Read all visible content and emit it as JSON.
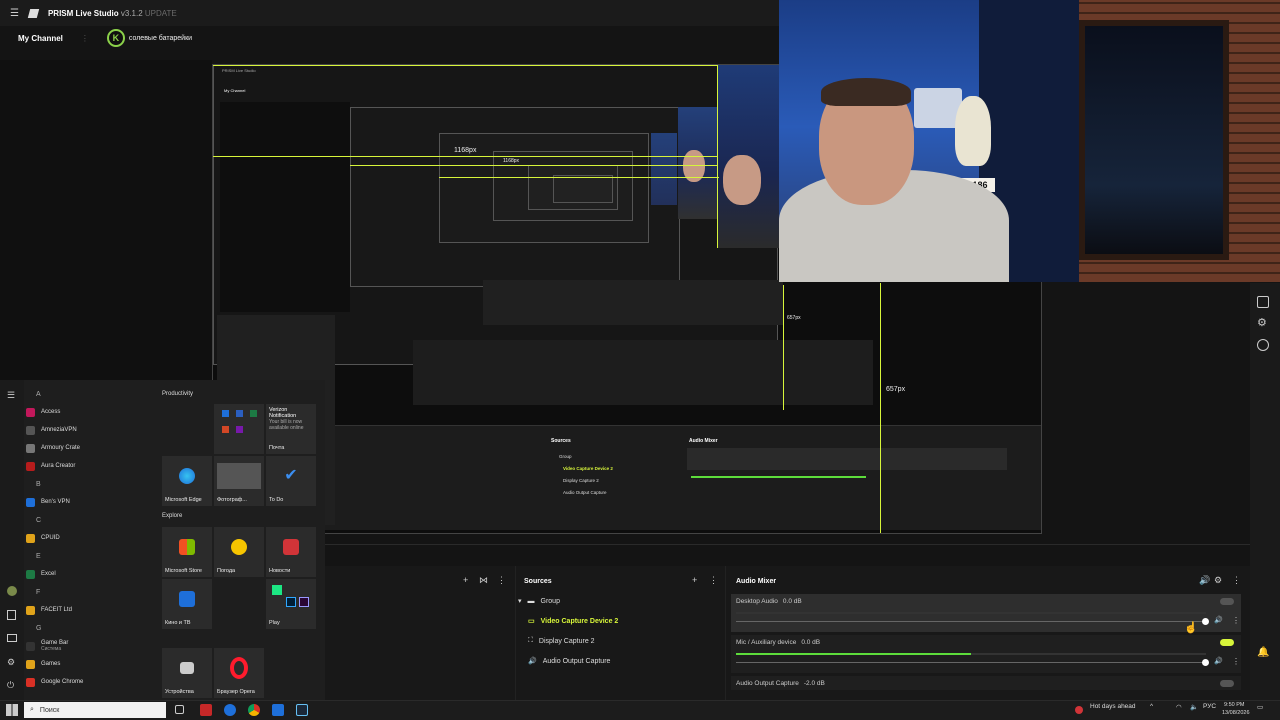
{
  "app": {
    "name": "PRISM Live Studio",
    "version": "v3.1.2",
    "update_label": "UPDATE",
    "channel_label": "My Channel",
    "channel_name": "солевые батарейки",
    "channel_logo_letter": "K"
  },
  "preview": {
    "width_label": "1168px",
    "height_label": "657px",
    "nested_width_label": "1168px",
    "nested_height_label": "657px"
  },
  "start_menu": {
    "productivity_header": "Productivity",
    "explore_header": "Explore",
    "apps": [
      {
        "type": "letter",
        "label": "A"
      },
      {
        "type": "app",
        "label": "Access",
        "color": "#c2185b"
      },
      {
        "type": "app",
        "label": "AmneziaVPN",
        "color": "#555555"
      },
      {
        "type": "app",
        "label": "Armoury Crate",
        "color": "#777777"
      },
      {
        "type": "app",
        "label": "Aura Creator",
        "color": "#b71c1c"
      },
      {
        "type": "letter",
        "label": "B"
      },
      {
        "type": "app",
        "label": "Ben's VPN",
        "color": "#1e6fd9"
      },
      {
        "type": "letter",
        "label": "C"
      },
      {
        "type": "app",
        "label": "CPUID",
        "color": "#e0a31a"
      },
      {
        "type": "letter",
        "label": "E"
      },
      {
        "type": "app",
        "label": "Excel",
        "color": "#1d7a44"
      },
      {
        "type": "letter",
        "label": "F"
      },
      {
        "type": "app",
        "label": "FACEIT Ltd",
        "color": "#e0a31a"
      },
      {
        "type": "letter",
        "label": "G"
      },
      {
        "type": "app",
        "label": "Game Bar",
        "sublabel": "Система",
        "color": "#333333"
      },
      {
        "type": "app",
        "label": "Games",
        "color": "#e0a31a"
      },
      {
        "type": "app",
        "label": "Google Chrome",
        "color": "#d93025"
      }
    ],
    "tiles": {
      "verizon_title": "Verizon Notification",
      "verizon_body": "Your bill is now available online",
      "pochta": "Почта",
      "edge": "Microsoft Edge",
      "photos": "Фотограф...",
      "todo": "To Do",
      "store": "Microsoft Store",
      "weather": "Погода",
      "news": "Новости",
      "movies": "Кино и ТВ",
      "play": "Play",
      "devices": "Устройства",
      "opera": "Браузер Opera"
    }
  },
  "panels": {
    "sources_title": "Sources",
    "sources": [
      {
        "label": "Group",
        "icon": "folder-icon",
        "selected": false,
        "indent": 0
      },
      {
        "label": "Video Capture Device 2",
        "icon": "camera-icon",
        "selected": true,
        "indent": 1
      },
      {
        "label": "Display Capture 2",
        "icon": "display-icon",
        "selected": false,
        "indent": 1
      },
      {
        "label": "Audio Output Capture",
        "icon": "speaker-icon",
        "selected": false,
        "indent": 1
      }
    ],
    "mixer_title": "Audio Mixer",
    "mixer": [
      {
        "label": "Desktop Audio",
        "db": "0.0 dB",
        "level": 0.0
      },
      {
        "label": "Mic / Auxiliary device",
        "db": "0.0 dB",
        "level": 0.5
      },
      {
        "label": "Audio Output Capture",
        "db": "-2.0 dB",
        "level": 0.0
      }
    ]
  },
  "taskbar": {
    "search_placeholder": "Поиск",
    "weather": "Hot days ahead",
    "lang": "РУС",
    "time": "9:50 PM",
    "date": "13/08/2026"
  },
  "webcam": {
    "plate_text": "26186"
  },
  "colors": {
    "accent": "#d7f53a",
    "meter": "#5ddc3b",
    "bg": "#141414"
  }
}
